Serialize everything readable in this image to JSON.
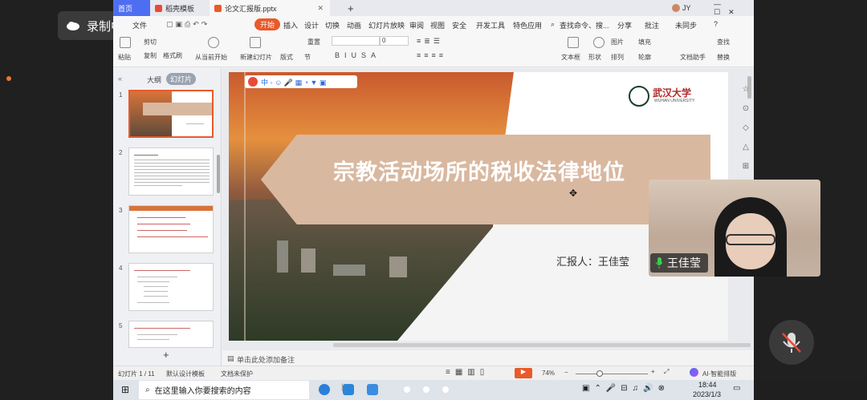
{
  "recording": {
    "label": "录制中"
  },
  "tabs": {
    "home": "首页",
    "template": "稻壳模板",
    "file": "论文汇报版.pptx"
  },
  "menus": [
    "文件",
    "开始",
    "插入",
    "设计",
    "切换",
    "动画",
    "幻灯片放映",
    "审阅",
    "视图",
    "安全",
    "开发工具",
    "特色应用"
  ],
  "menu_search": "查找命令、搜...",
  "menu_right": {
    "share": "分享",
    "comment": "批注",
    "sync": "未同步"
  },
  "user": "JY",
  "ribbon": {
    "paste": "粘贴",
    "cut": "剪切",
    "copy": "复制",
    "format": "格式刷",
    "from_current": "从当前开始",
    "new_slide": "新建幻灯片",
    "layout": "版式",
    "section": "节",
    "reset": "重置",
    "font_size": "0",
    "textbox": "文本框",
    "shape": "形状",
    "arrange": "排列",
    "outline": "轮廓",
    "picture": "图片",
    "fill": "填充",
    "find": "查找",
    "replace": "替换",
    "assistant": "文档助手"
  },
  "pane": {
    "outline_tab": "大纲",
    "slides_tab": "幻灯片"
  },
  "thumb_numbers": [
    "1",
    "2",
    "3",
    "4",
    "5"
  ],
  "slide": {
    "title": "宗教活动场所的税收法律地位",
    "reporter": "汇报人：王佳莹",
    "logo_cn": "武汉大学",
    "logo_en": "WUHAN UNIVERSITY"
  },
  "notes_placeholder": "单击此处添加备注",
  "statusbar": {
    "slide_count": "幻灯片 1 / 11",
    "template": "默认设计模板",
    "protect": "文档未保护",
    "zoom": "74%",
    "ai": "AI·智能排版"
  },
  "webcam": {
    "name": "王佳莹"
  },
  "taskbar": {
    "search_placeholder": "在这里输入你要搜索的内容",
    "time": "18:44",
    "date": "2023/1/3"
  },
  "colors": {
    "accent": "#e95a2a",
    "banner": "#d9b8a0",
    "wps_blue": "#4e6ef2"
  }
}
